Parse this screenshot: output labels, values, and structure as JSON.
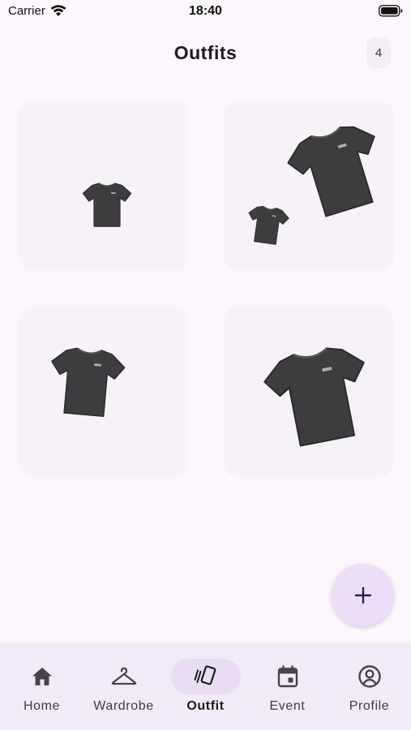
{
  "status_bar": {
    "carrier": "Carrier",
    "time": "18:40"
  },
  "header": {
    "title": "Outfits",
    "count": "4"
  },
  "outfits": [
    {
      "items": [
        "t-shirt"
      ]
    },
    {
      "items": [
        "t-shirt",
        "t-shirt"
      ]
    },
    {
      "items": [
        "t-shirt"
      ]
    },
    {
      "items": [
        "t-shirt"
      ]
    }
  ],
  "fab": {
    "icon": "plus-icon"
  },
  "bottom_nav": {
    "items": [
      {
        "label": "Home",
        "icon": "home-icon"
      },
      {
        "label": "Wardrobe",
        "icon": "hanger-icon"
      },
      {
        "label": "Outfit",
        "icon": "outfit-cards-icon",
        "active": true
      },
      {
        "label": "Event",
        "icon": "calendar-icon"
      },
      {
        "label": "Profile",
        "icon": "profile-icon"
      }
    ]
  },
  "colors": {
    "background": "#fdf7fd",
    "card": "#f7f2f8",
    "fab": "#ecdef7",
    "nav_bar": "#f2ebf5",
    "nav_active": "#e8dcf3",
    "tshirt": "#3d3d3f"
  }
}
